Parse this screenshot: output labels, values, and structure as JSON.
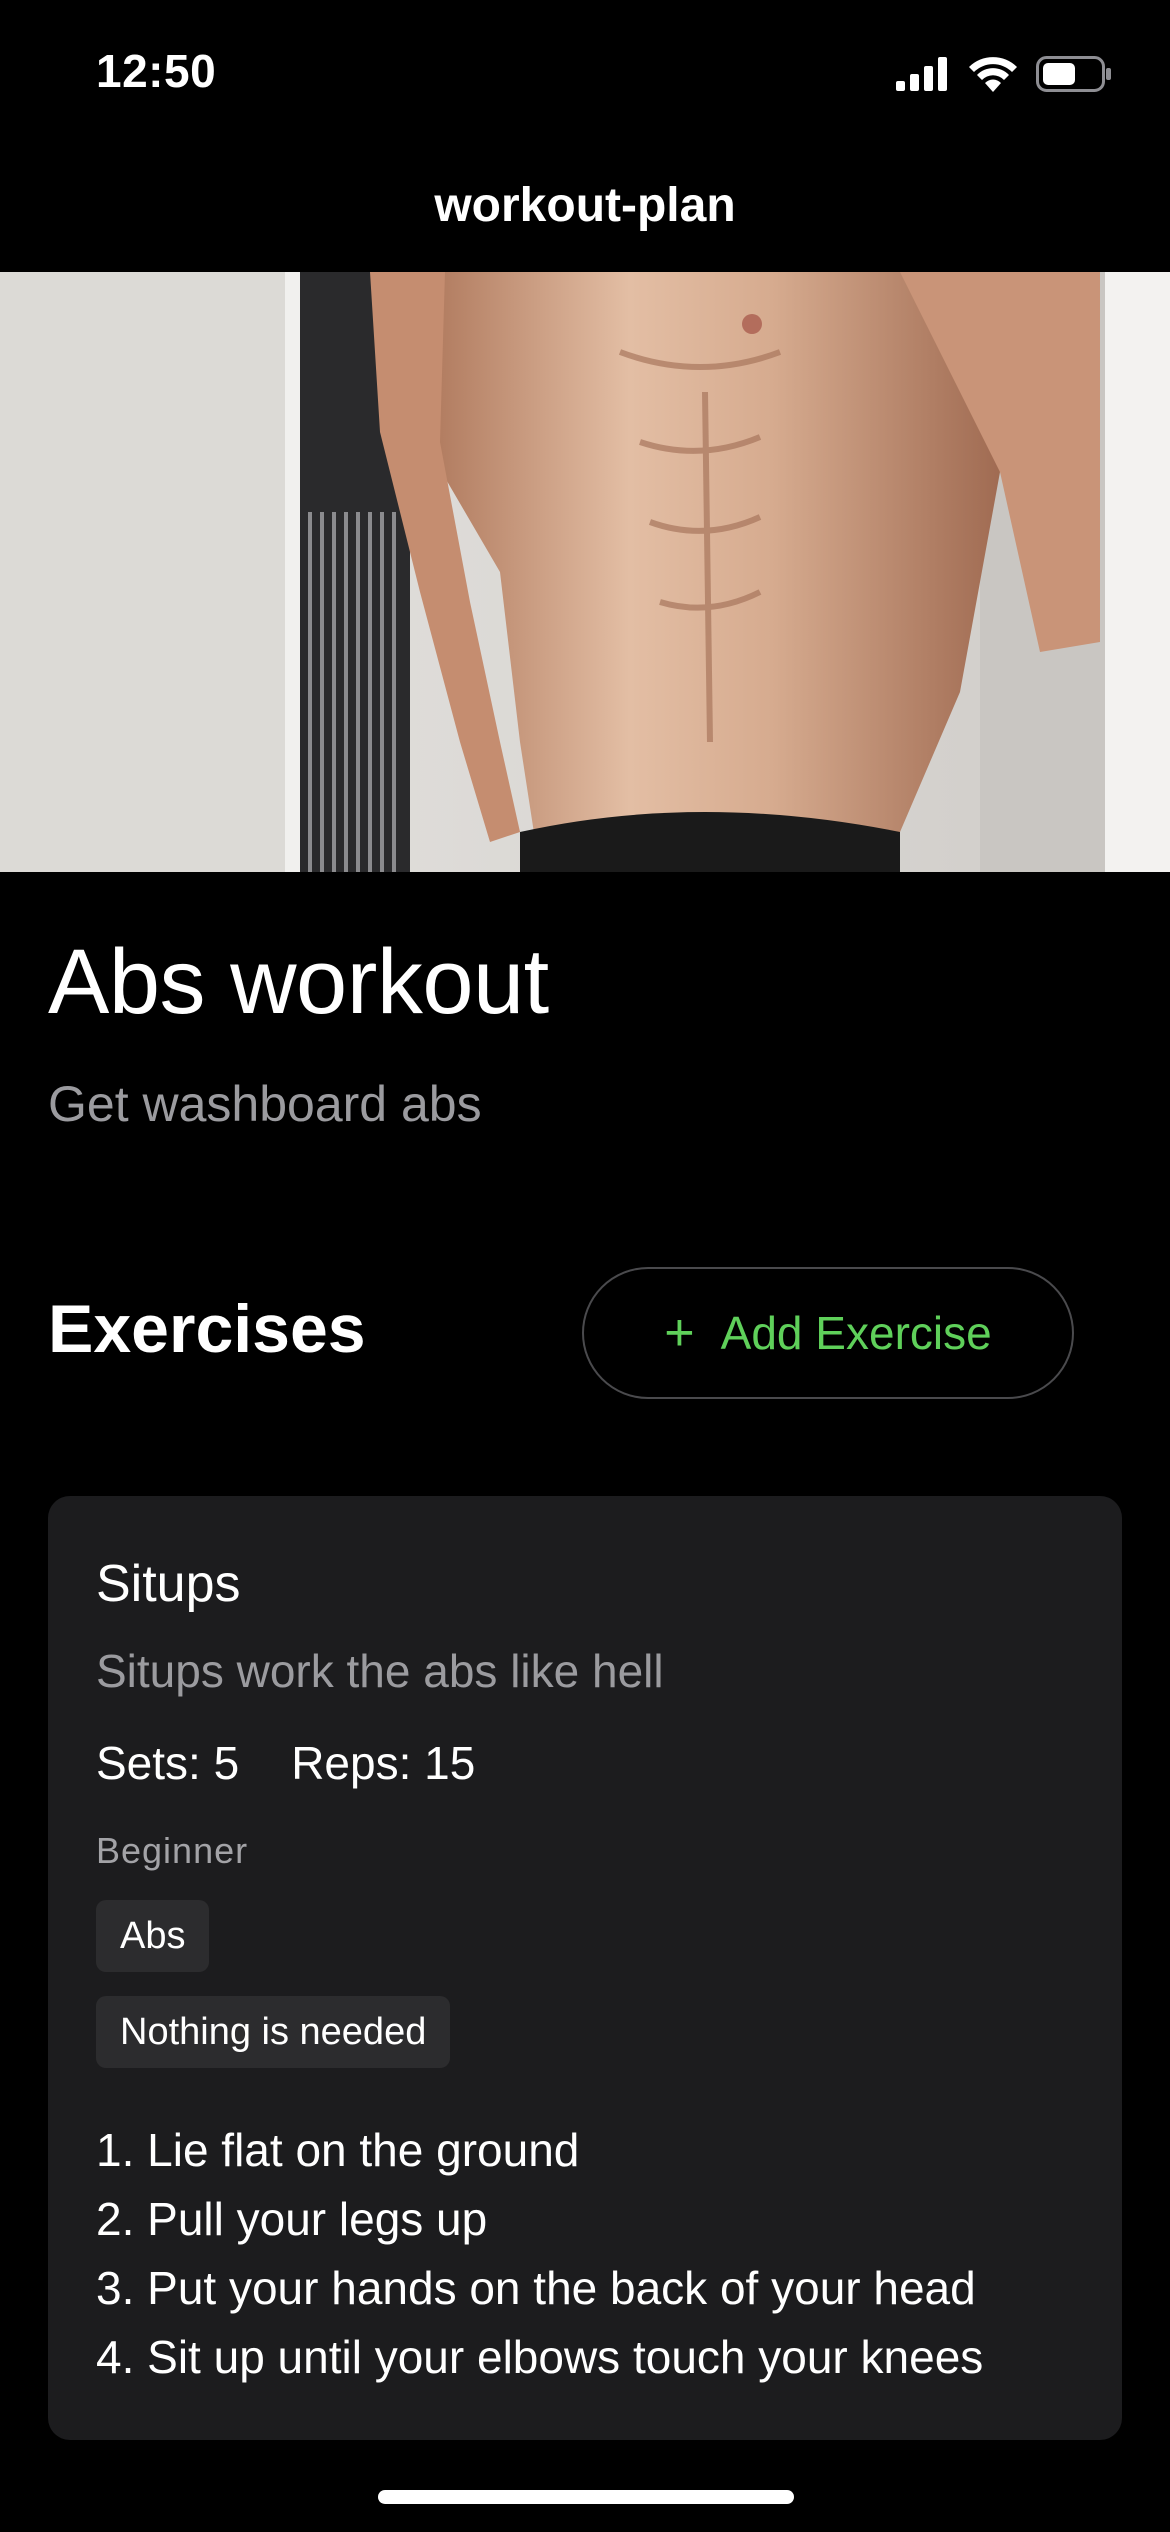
{
  "status": {
    "time": "12:50",
    "icons": [
      "signal-icon",
      "wifi-icon",
      "battery-icon"
    ]
  },
  "nav": {
    "title": "workout-plan"
  },
  "hero": {
    "image": "abs-photo"
  },
  "plan": {
    "title": "Abs workout",
    "description": "Get washboard abs"
  },
  "exercises": {
    "heading": "Exercises",
    "add_button": {
      "icon": "+",
      "label": "Add Exercise"
    },
    "items": [
      {
        "name": "Situps",
        "description": "Situps work the abs like hell",
        "sets": "Sets: 5",
        "reps": "Reps: 15",
        "level": "Beginner",
        "tags": [
          "Abs",
          "Nothing is needed"
        ],
        "steps": [
          "1. Lie flat on the ground",
          "2. Pull your legs up",
          "3. Put your hands on the back of your head",
          "4. Sit up until your elbows touch your knees"
        ]
      }
    ]
  },
  "colors": {
    "background": "#000000",
    "card": "#1c1c1e",
    "accent": "#5fd05a",
    "secondary_text": "#9b9b9f"
  }
}
